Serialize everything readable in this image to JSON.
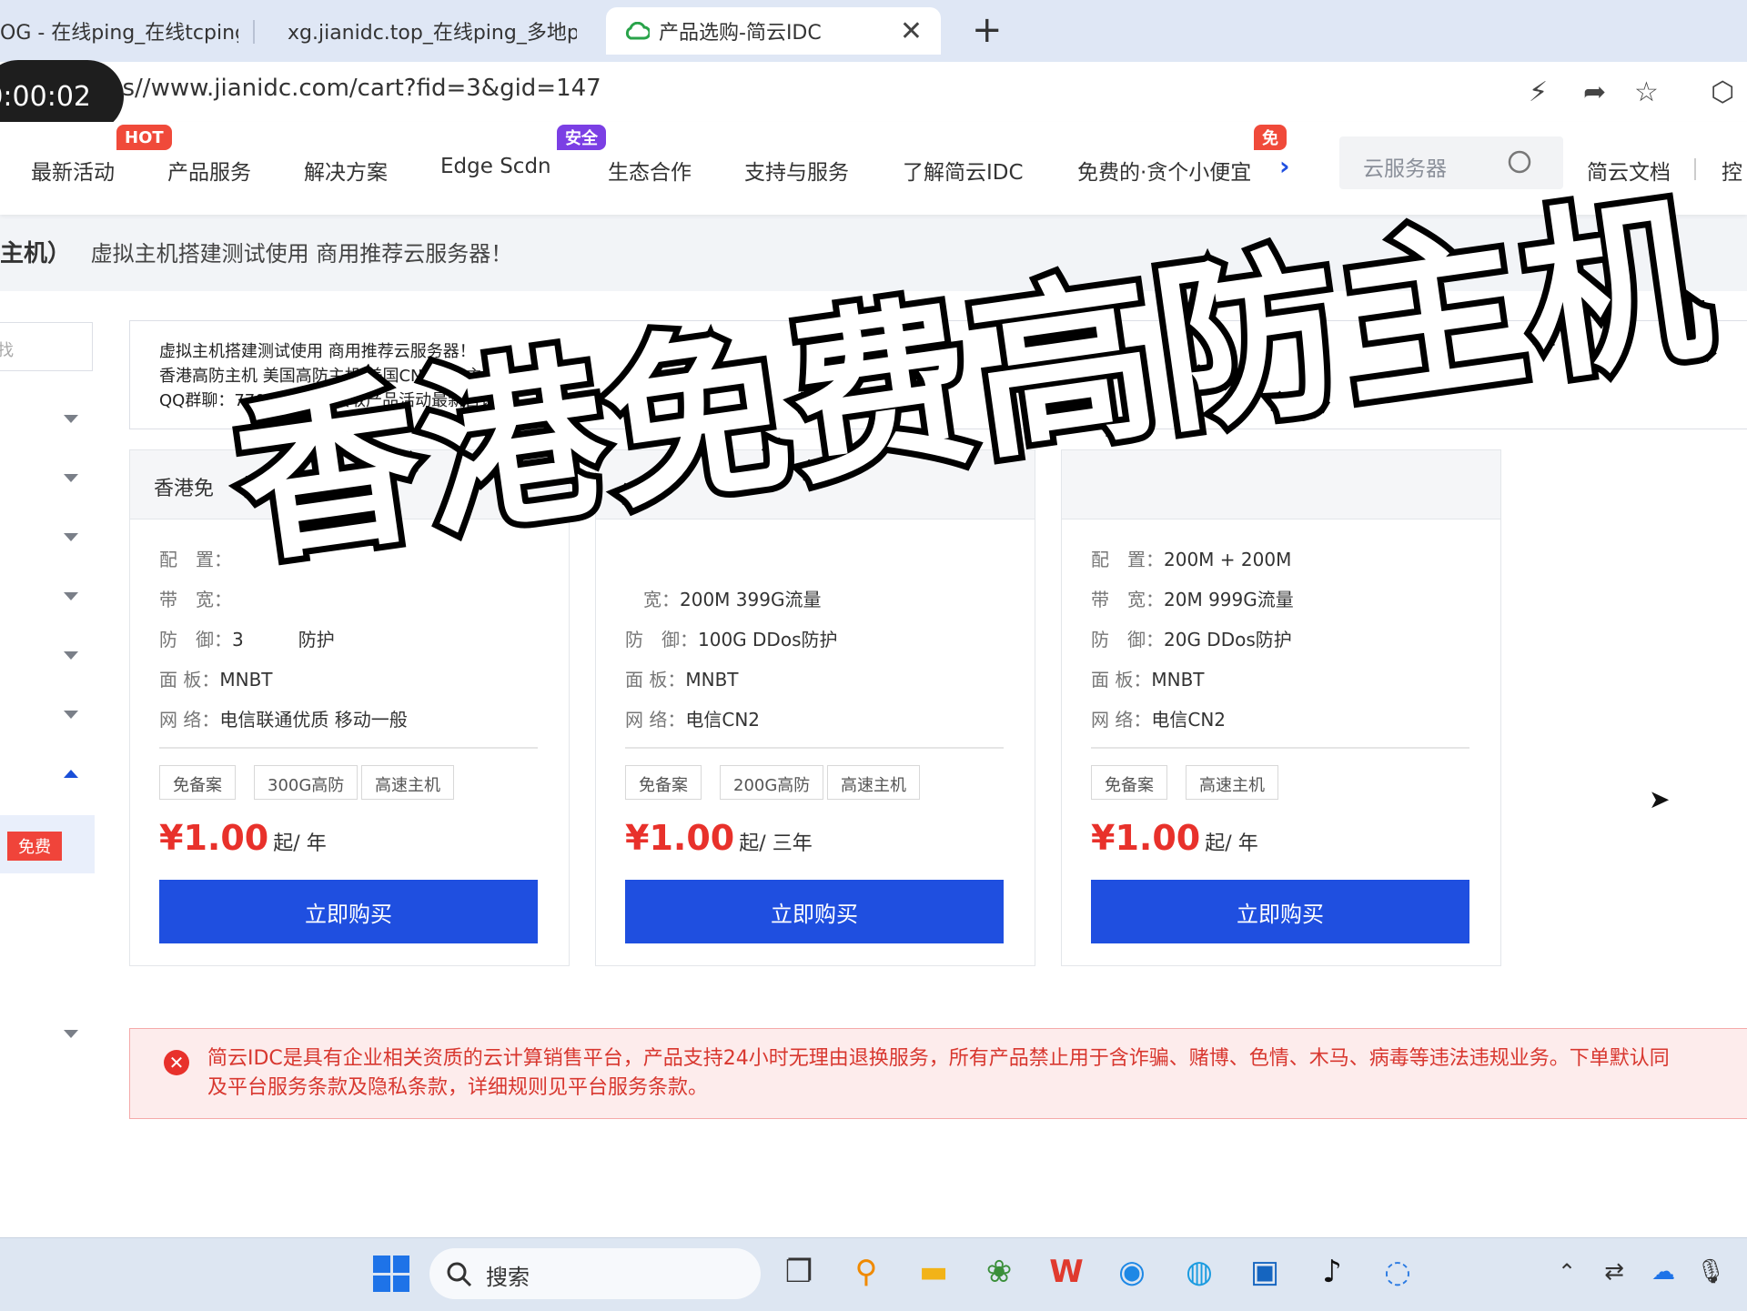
{
  "browser": {
    "tabs": [
      {
        "title": "OG - 在线ping_在线tcping_"
      },
      {
        "title": "xg.jianidc.top_在线ping_多地pi"
      },
      {
        "title": "产品选购-简云IDC"
      }
    ],
    "new_tab": "+",
    "close": "✕",
    "url": "ps//www.jianidc.com/cart?fid=3&gid=147",
    "timer": "0:00:02"
  },
  "site_nav": {
    "items": [
      "最新活动",
      "产品服务",
      "解决方案",
      "Edge Scdn",
      "生态合作",
      "支持与服务",
      "了解简云IDC",
      "免费的·贪个小便宜"
    ],
    "badges": {
      "hot": "HOT",
      "safe": "安全",
      "free": "免"
    },
    "search_placeholder": "云服务器",
    "docs": "简云文档",
    "console": "控"
  },
  "breadcrumb": {
    "title": "主机）",
    "subtitle": "虚拟主机搭建测试使用 商用推荐云服务器！"
  },
  "sidebar": {
    "search_placeholder": "找",
    "free_badge": "免费"
  },
  "notice": [
    "虚拟主机搭建测试使用 商用推荐云服务器！",
    "香港高防主机 美国高防主机 美国CN2高速主机 多种可选",
    "QQ群聊：770231995 获取产品活动最新咨询"
  ],
  "products": [
    {
      "title": "香港免",
      "specs": [
        {
          "k": "配　置：",
          "v": ""
        },
        {
          "k": "带　宽：",
          "v": ""
        },
        {
          "k": "防　御：",
          "v": "3　　　防护"
        },
        {
          "k": "面 板：",
          "v": "MNBT"
        },
        {
          "k": "网 络：",
          "v": "电信联通优质 移动一般"
        }
      ],
      "tags": [
        "免备案",
        "300G高防",
        "高速主机"
      ],
      "price": "¥1.00",
      "unit": "起/ 年",
      "buy": "立即购买"
    },
    {
      "title": "",
      "specs": [
        {
          "k": "",
          "v": ""
        },
        {
          "k": "　宽：",
          "v": "200M 399G流量"
        },
        {
          "k": "防　御：",
          "v": "100G DDos防护"
        },
        {
          "k": "面 板：",
          "v": "MNBT"
        },
        {
          "k": "网 络：",
          "v": "电信CN2"
        }
      ],
      "tags": [
        "免备案",
        "200G高防",
        "高速主机"
      ],
      "price": "¥1.00",
      "unit": "起/ 三年",
      "buy": "立即购买"
    },
    {
      "title": "",
      "specs": [
        {
          "k": "配　置：",
          "v": "200M + 200M"
        },
        {
          "k": "带　宽：",
          "v": "20M 999G流量"
        },
        {
          "k": "防　御：",
          "v": "20G DDos防护"
        },
        {
          "k": "面 板：",
          "v": "MNBT"
        },
        {
          "k": "网 络：",
          "v": "电信CN2"
        }
      ],
      "tags": [
        "免备案",
        "高速主机"
      ],
      "price": "¥1.00",
      "unit": "起/ 年",
      "buy": "立即购买"
    }
  ],
  "alert": {
    "line1": "简云IDC是具有企业相关资质的云计算销售平台，产品支持24小时无理由退换服务，所有产品禁止用于含诈骗、赌博、色情、木马、病毒等违法违规业务。下单默认同",
    "line2": "及平台服务条款及隐私条款，详细规则见平台服务条款。"
  },
  "overlay_title": "香港免费高防主机",
  "taskbar": {
    "search_label": "搜索"
  },
  "colors": {
    "accent": "#1f4fe0",
    "price": "#e8312b",
    "alert_bg": "#fdecec"
  }
}
